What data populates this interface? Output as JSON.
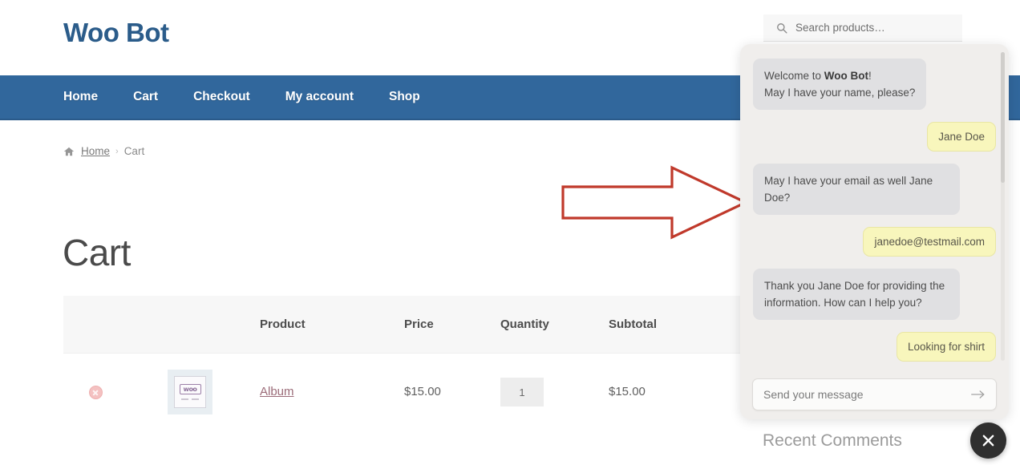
{
  "site": {
    "title": "Woo Bot",
    "brand_color": "#2b5c8a",
    "nav_bar_color": "#31679c"
  },
  "search": {
    "icon": "search-icon",
    "placeholder": "Search products…",
    "value": ""
  },
  "nav": {
    "items": [
      {
        "label": "Home"
      },
      {
        "label": "Cart"
      },
      {
        "label": "Checkout"
      },
      {
        "label": "My account"
      },
      {
        "label": "Shop"
      }
    ]
  },
  "breadcrumb": {
    "home_icon": "home-icon",
    "home_label": "Home",
    "separator": "›",
    "current": "Cart"
  },
  "page": {
    "title": "Cart"
  },
  "cart": {
    "headers": {
      "remove": "",
      "thumbnail": "",
      "product": "Product",
      "price": "Price",
      "quantity": "Quantity",
      "subtotal": "Subtotal"
    },
    "rows": [
      {
        "remove_icon": "remove-item-icon",
        "thumbnail_alt": "woo-placeholder-image",
        "thumbnail_text": "woo",
        "product": "Album",
        "price": "$15.00",
        "quantity": "1",
        "subtotal": "$15.00"
      }
    ]
  },
  "annotation": {
    "arrow_color": "#c0392b",
    "arrow_direction": "right"
  },
  "chat": {
    "messages": [
      {
        "from": "bot",
        "lines": [
          {
            "prefix": "Welcome to ",
            "strong": "Woo Bot",
            "suffix": "!"
          },
          {
            "prefix": "May I have your name, please?",
            "strong": "",
            "suffix": ""
          }
        ]
      },
      {
        "from": "user",
        "text": "Jane Doe"
      },
      {
        "from": "bot",
        "text": "May I have your email as well Jane Doe?"
      },
      {
        "from": "user",
        "text": "janedoe@testmail.com"
      },
      {
        "from": "bot",
        "text": "Thank you Jane Doe for providing the information. How can I help you?"
      },
      {
        "from": "user",
        "text": "Looking for shirt"
      }
    ],
    "input": {
      "placeholder": "Send your message",
      "value": "",
      "send_icon": "send-arrow-icon"
    },
    "close_icon": "close-icon",
    "bot_bubble_color": "#e0e0e2",
    "user_bubble_color": "#f8f6bc"
  },
  "sidebar": {
    "recent_comments_title": "Recent Comments"
  }
}
